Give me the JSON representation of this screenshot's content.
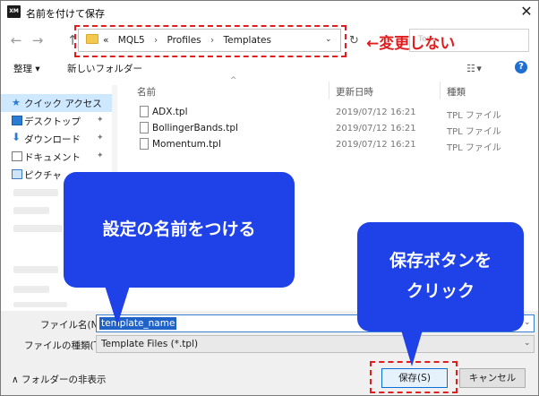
{
  "window": {
    "app_icon_text": "XM",
    "title": "名前を付けて保存",
    "close_glyph": "✕"
  },
  "nav": {
    "back_glyph": "←",
    "forward_glyph": "→",
    "up_glyph": "↑",
    "breadcrumb_prefix": "«",
    "breadcrumbs": [
      "MQL5",
      "Profiles",
      "Templates"
    ],
    "breadcrumb_sep": "›",
    "dropdown_glyph": "⌄",
    "refresh_glyph": "↻",
    "search_placeholder": "Ten..."
  },
  "annotations": {
    "no_change_label": "←変更しない",
    "name_callout": "設定の名前をつける",
    "save_callout_line1": "保存ボタンを",
    "save_callout_line2": "クリック",
    "red_color": "#e11d1d",
    "callout_color": "#1f41e8"
  },
  "toolbar": {
    "organize": "整理 ▾",
    "new_folder": "新しいフォルダー",
    "view_glyph": "☷ ▾",
    "help_glyph": "?"
  },
  "sidebar": {
    "items": [
      {
        "label": "クイック アクセス",
        "icon": "star-icon"
      },
      {
        "label": "デスクトップ",
        "icon": "desktop-icon"
      },
      {
        "label": "ダウンロード",
        "icon": "download-icon"
      },
      {
        "label": "ドキュメント",
        "icon": "document-icon"
      },
      {
        "label": "ピクチャ",
        "icon": "picture-icon"
      }
    ],
    "pin_glyph": "📌"
  },
  "file_list": {
    "columns": [
      "名前",
      "更新日時",
      "種類"
    ],
    "sort_caret": "^",
    "rows": [
      {
        "name": "ADX.tpl",
        "date": "2019/07/12 16:21",
        "type": "TPL ファイル"
      },
      {
        "name": "BollingerBands.tpl",
        "date": "2019/07/12 16:21",
        "type": "TPL ファイル"
      },
      {
        "name": "Momentum.tpl",
        "date": "2019/07/12 16:21",
        "type": "TPL ファイル"
      }
    ]
  },
  "form": {
    "filename_label": "ファイル名(N):",
    "filename_value": "template_name",
    "filetype_label": "ファイルの種類(T):",
    "filetype_value": "Template Files (*.tpl)",
    "caret": "⌄",
    "toggle_folders": "∧  フォルダーの非表示",
    "save_button": "保存(S)",
    "cancel_button": "キャンセル"
  }
}
